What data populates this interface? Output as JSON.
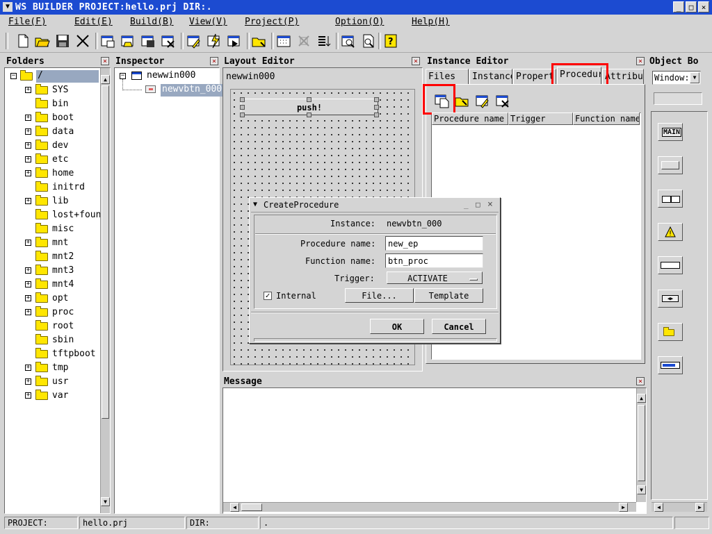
{
  "window": {
    "title": "WS BUILDER PROJECT:hello.prj DIR:."
  },
  "menus": [
    "File(F)",
    "Edit(E)",
    "Build(B)",
    "View(V)",
    "Project(P)",
    "Option(O)",
    "Help(H)"
  ],
  "folders": {
    "title": "Folders",
    "root": "/",
    "items": [
      {
        "name": "SYS",
        "expandable": true
      },
      {
        "name": "bin",
        "expandable": false
      },
      {
        "name": "boot",
        "expandable": true
      },
      {
        "name": "data",
        "expandable": true
      },
      {
        "name": "dev",
        "expandable": true
      },
      {
        "name": "etc",
        "expandable": true
      },
      {
        "name": "home",
        "expandable": true
      },
      {
        "name": "initrd",
        "expandable": false
      },
      {
        "name": "lib",
        "expandable": true
      },
      {
        "name": "lost+found",
        "expandable": false
      },
      {
        "name": "misc",
        "expandable": false
      },
      {
        "name": "mnt",
        "expandable": true
      },
      {
        "name": "mnt2",
        "expandable": false
      },
      {
        "name": "mnt3",
        "expandable": true
      },
      {
        "name": "mnt4",
        "expandable": true
      },
      {
        "name": "opt",
        "expandable": true
      },
      {
        "name": "proc",
        "expandable": true
      },
      {
        "name": "root",
        "expandable": false
      },
      {
        "name": "sbin",
        "expandable": false
      },
      {
        "name": "tftpboot",
        "expandable": false
      },
      {
        "name": "tmp",
        "expandable": true
      },
      {
        "name": "usr",
        "expandable": true
      },
      {
        "name": "var",
        "expandable": true
      }
    ]
  },
  "inspector": {
    "title": "Inspector",
    "root": "newwin000",
    "child": "newvbtn_000"
  },
  "layout_editor": {
    "title": "Layout Editor",
    "window_name": "newwin000",
    "button_label": "push!"
  },
  "instance_editor": {
    "title": "Instance Editor",
    "tabs": [
      "Files",
      "Instance",
      "Propert",
      "Procedur",
      "Attribut"
    ],
    "columns": [
      "Procedure name",
      "Trigger",
      "Function name"
    ]
  },
  "object_box": {
    "title": "Object Bo",
    "selector": "Window:",
    "main_label": "MAIN"
  },
  "message": {
    "title": "Message"
  },
  "dialog": {
    "title": "CreateProcedure",
    "instance_label": "Instance:",
    "instance_value": "newvbtn_000",
    "procedure_label": "Procedure name:",
    "procedure_value": "new_ep",
    "function_label": "Function name:",
    "function_value": "btn_proc",
    "trigger_label": "Trigger:",
    "trigger_value": "ACTIVATE",
    "internal_label": "Internal",
    "file_button": "File...",
    "template_button": "Template",
    "ok_button": "OK",
    "cancel_button": "Cancel"
  },
  "status": {
    "project_label": "PROJECT:",
    "project_value": "hello.prj",
    "dir_label": "DIR:",
    "dir_value": "."
  },
  "colors": {
    "titlebar": "#1c4bd1",
    "highlight": "#ff0000",
    "selection": "#98a8c0"
  }
}
